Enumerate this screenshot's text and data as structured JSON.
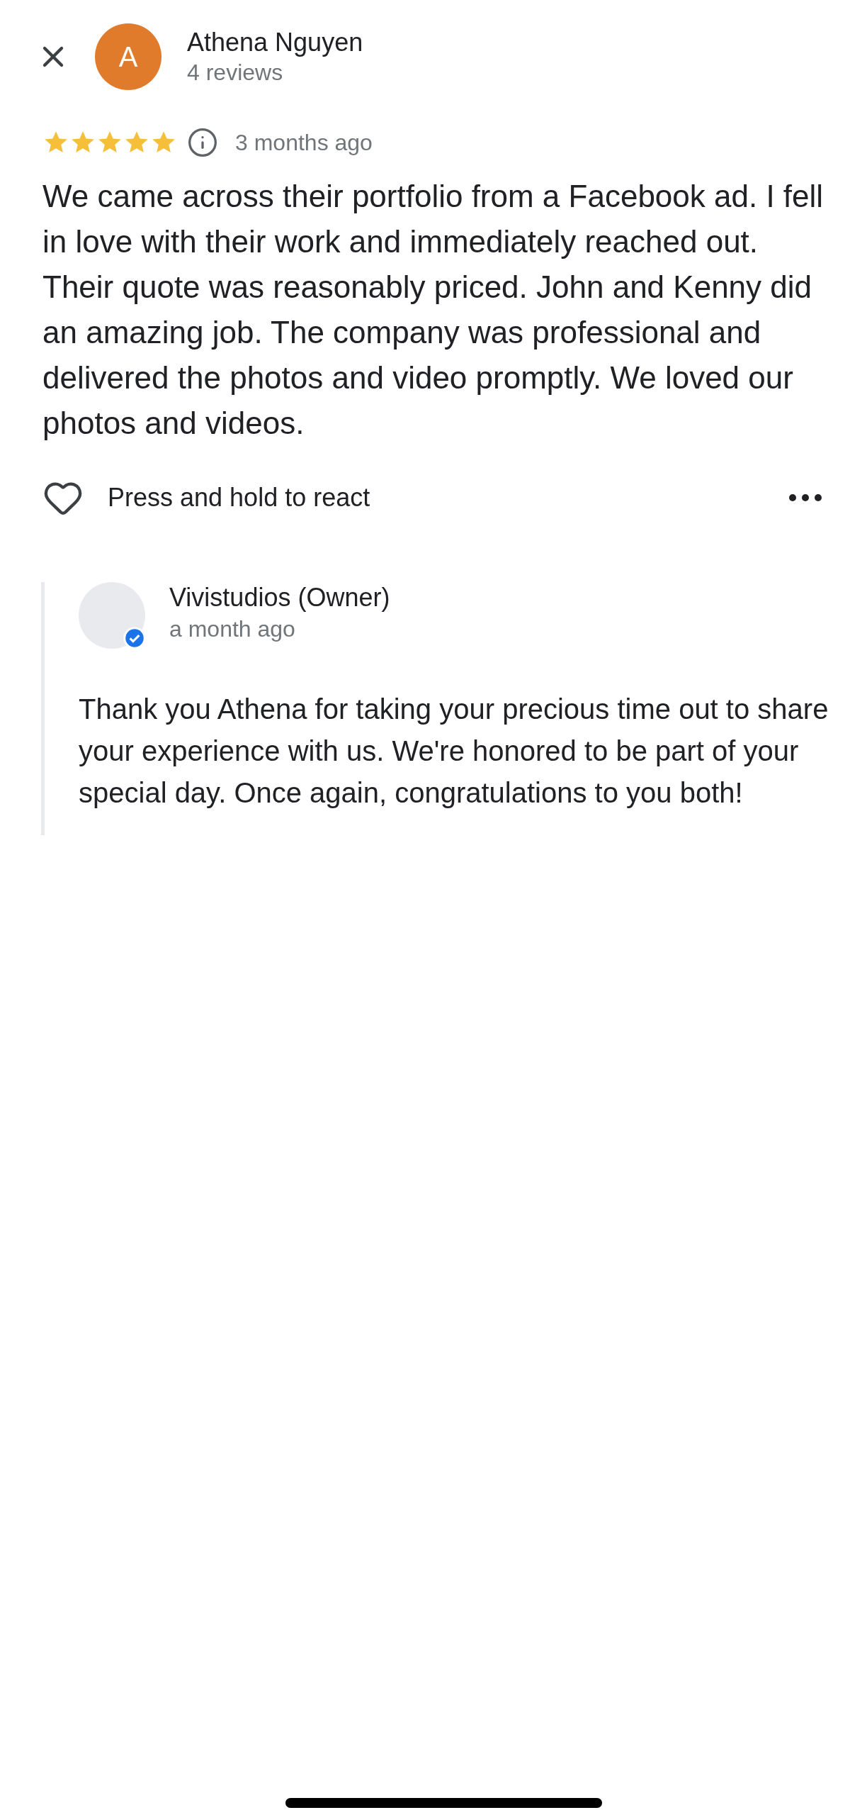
{
  "review": {
    "author": {
      "initial": "A",
      "name": "Athena Nguyen",
      "reviews": "4 reviews",
      "color": "#e07b2c"
    },
    "stars": 5,
    "time": "3 months ago",
    "text": "We came across their portfolio from a Facebook ad. I fell in love with their work and immediately reached out. Their quote was reasonably priced. John and Kenny did an amazing job. The company was professional and delivered the photos and video promptly. We loved our photos and videos.",
    "react_label": "Press and hold to react"
  },
  "owner_reply": {
    "name": "Vivistudios (Owner)",
    "time": "a month ago",
    "verified": true,
    "text": "Thank you Athena for taking your precious time out to share your experience with us. We're honored to be part of your special day. Once again, congratulations to you both!"
  }
}
